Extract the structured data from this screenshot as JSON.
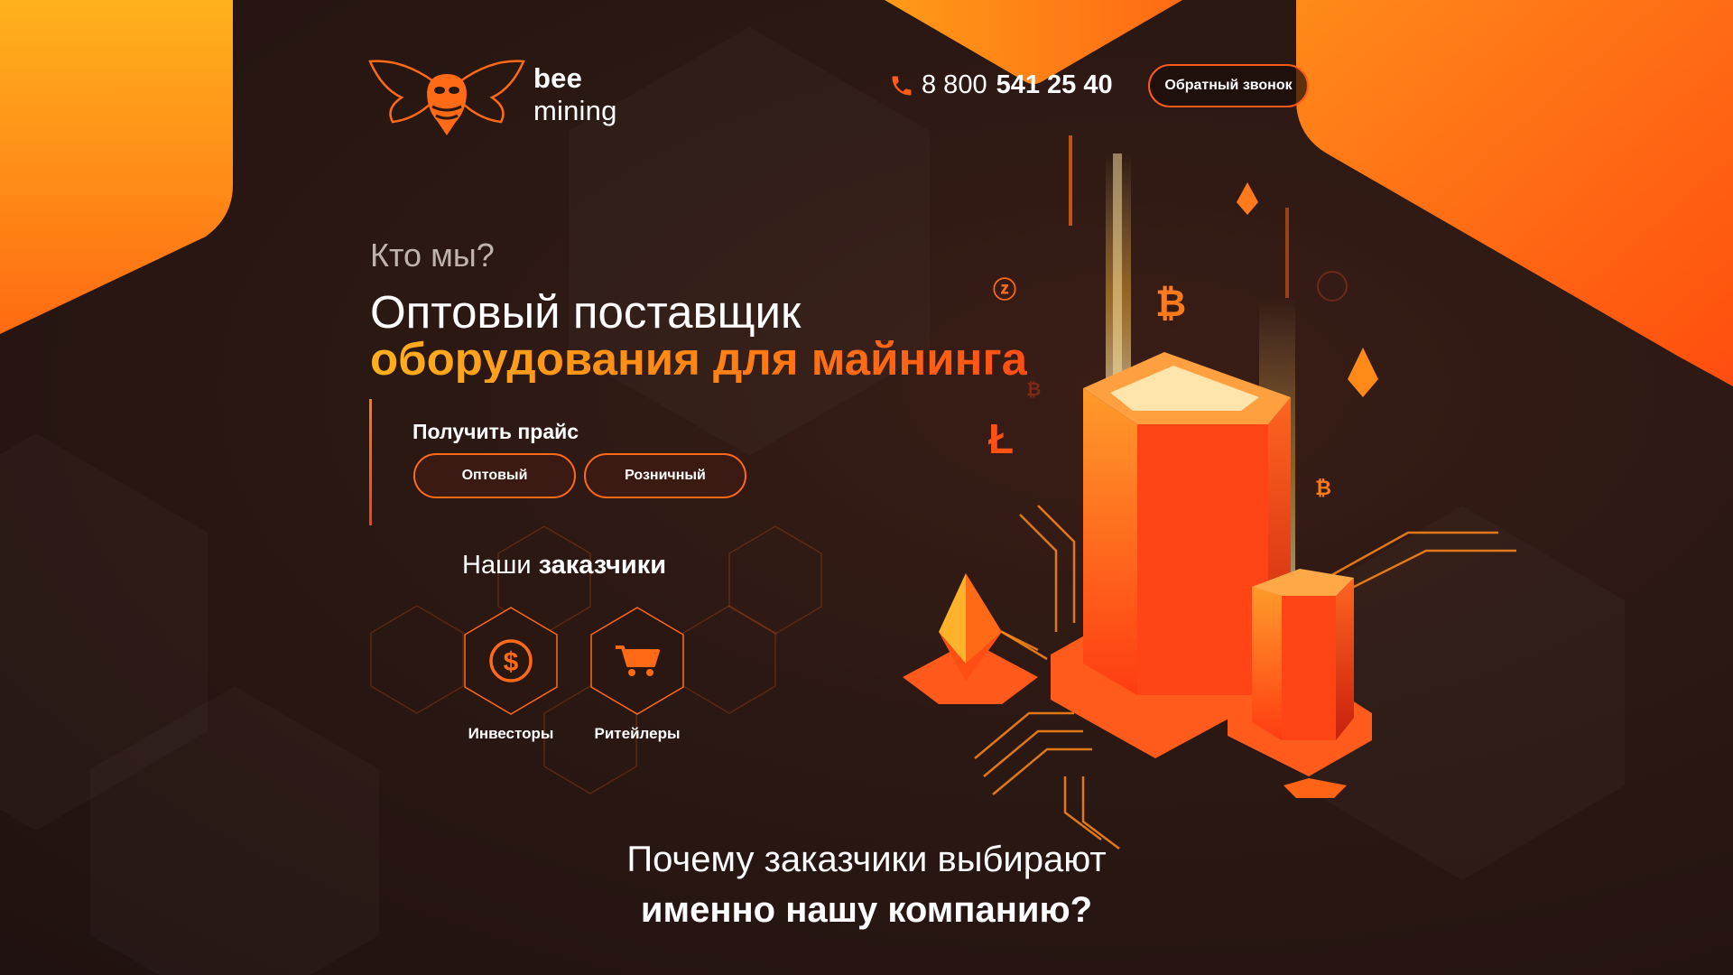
{
  "brand": {
    "name_bold": "bee",
    "name_rest": " mining"
  },
  "header": {
    "phone_prefix": "8 800",
    "phone_main": "541 25 40",
    "callback_label": "Обратный звонок"
  },
  "hero": {
    "eyebrow": "Кто мы?",
    "title_line1": "Оптовый поставщик",
    "title_line2": "оборудования для майнинга"
  },
  "pricing": {
    "title": "Получить прайс",
    "buttons": {
      "wholesale": "Оптовый",
      "retail": "Розничный"
    }
  },
  "clients": {
    "title_regular": "Наши ",
    "title_bold": "заказчики",
    "items": [
      {
        "label": "Инвесторы",
        "icon": "dollar-coin-icon"
      },
      {
        "label": "Ритейлеры",
        "icon": "shopping-cart-icon"
      }
    ]
  },
  "why": {
    "line1": "Почему заказчики выбирают",
    "line2": "именно нашу компанию?"
  },
  "colors": {
    "accent_orange": "#ff6a16",
    "accent_yellow": "#ffb01e",
    "background_dark": "#2a1712"
  }
}
